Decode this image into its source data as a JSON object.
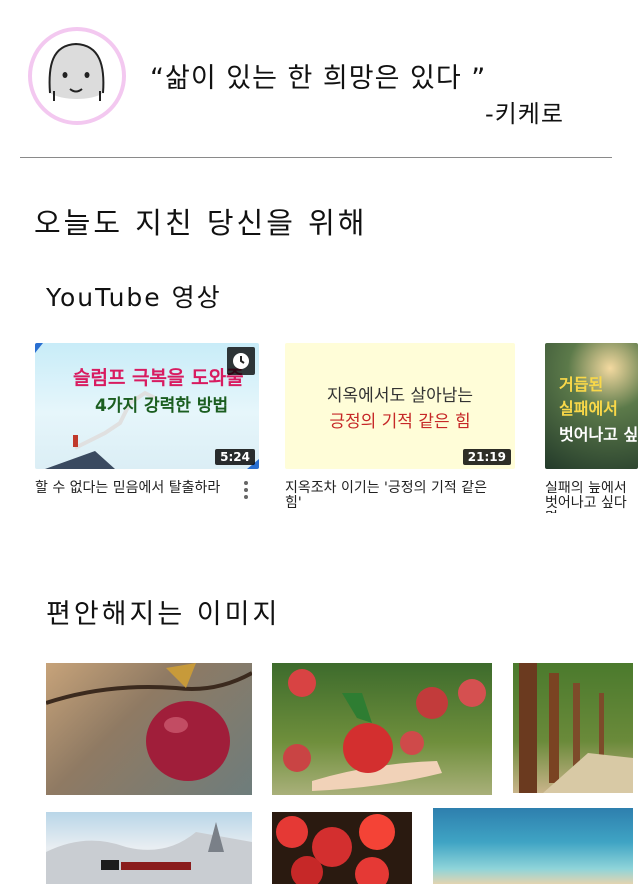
{
  "header": {
    "quote": "“삶이 있는 한 희망은 있다 ”",
    "author": "-키케로"
  },
  "main": {
    "section_title": "오늘도 지친 당신을 위해",
    "youtube_title": "YouTube 영상",
    "images_title": "편안해지는 이미지"
  },
  "videos": [
    {
      "thumb_line1": "슬럼프 극복을 도와줄",
      "thumb_line2": "4가지 강력한 방법",
      "duration": "5:24",
      "title": "할 수 없다는 믿음에서 탈출하라"
    },
    {
      "thumb_line1": "지옥에서도 살아남는",
      "thumb_line2": "긍정의 기적 같은 힘",
      "duration": "21:19",
      "title": "지옥조차 이기는 '긍정의 기적 같은 힘'"
    },
    {
      "thumb_line1": "거듭된",
      "thumb_line2": "실패에서",
      "thumb_line3": "벗어나고 싶",
      "title": "실패의 늪에서 벗어나고 싶다면"
    }
  ],
  "icons": {
    "watch_later": "clock-icon",
    "more": "more-vert-icon"
  }
}
